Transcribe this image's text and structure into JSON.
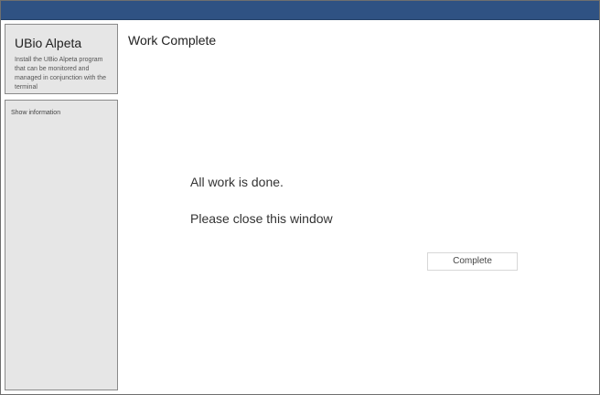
{
  "sidebar": {
    "title": "UBio Alpeta",
    "description": "Install the UBio Alpeta program that can be monitored and managed in conjunction with the terminal",
    "info_link": "Show information"
  },
  "main": {
    "title": "Work Complete",
    "message_line_1": "All work is done.",
    "message_line_2": "Please close this window",
    "complete_button": "Complete"
  }
}
